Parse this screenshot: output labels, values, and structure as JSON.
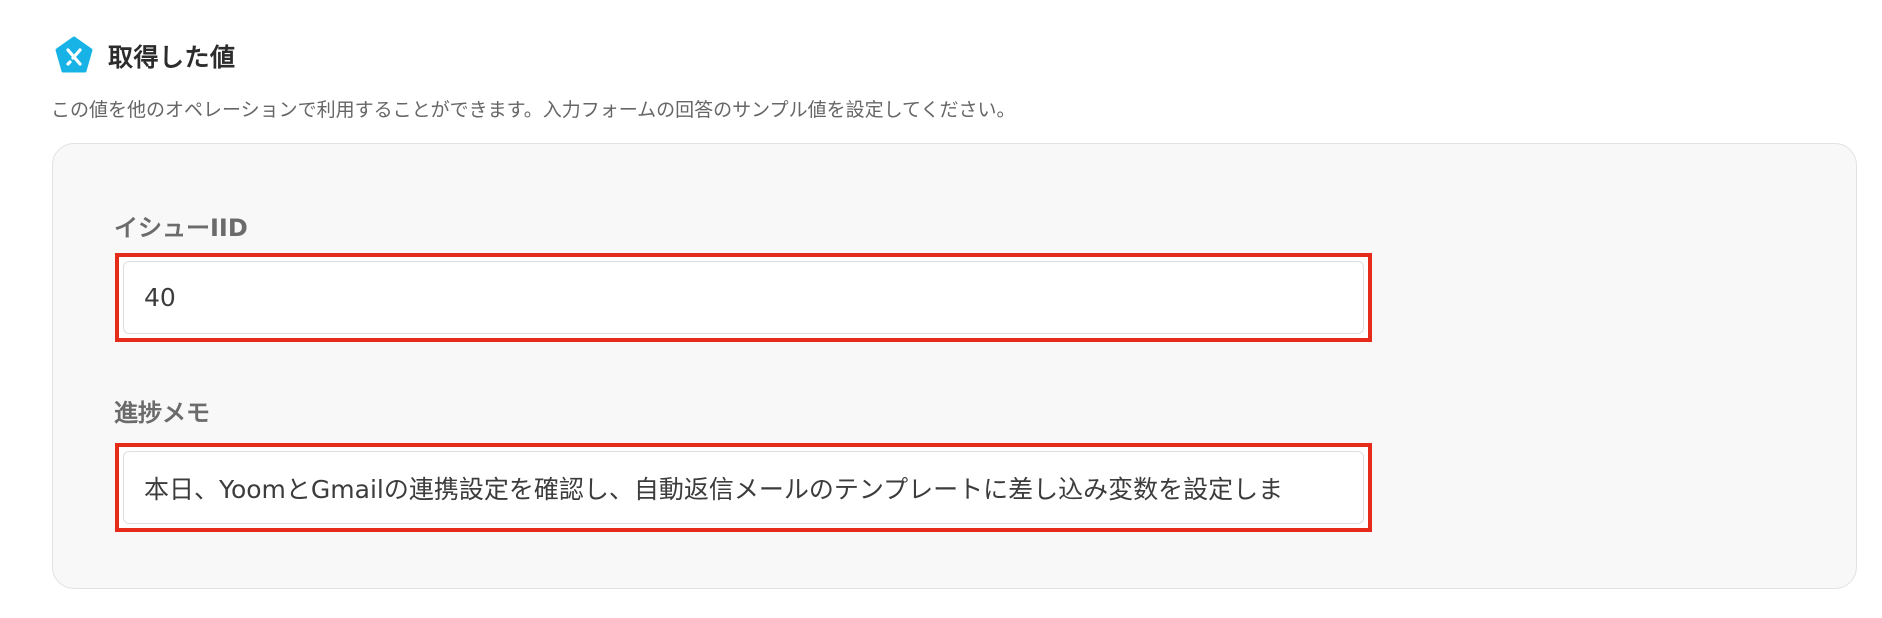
{
  "header": {
    "title": "取得した値",
    "icon": "yoom-logo-icon",
    "icon_color": "#18b3e6"
  },
  "description": "この値を他のオペレーションで利用することができます。入力フォームの回答のサンプル値を設定してください。",
  "fields": [
    {
      "label": "イシューIID",
      "value": "40"
    },
    {
      "label": "進捗メモ",
      "value": "本日、YoomとGmailの連携設定を確認し、自動返信メールのテンプレートに差し込み変数を設定しま"
    }
  ],
  "colors": {
    "highlight": "#e52b1a",
    "card_background": "#f8f8f8"
  }
}
